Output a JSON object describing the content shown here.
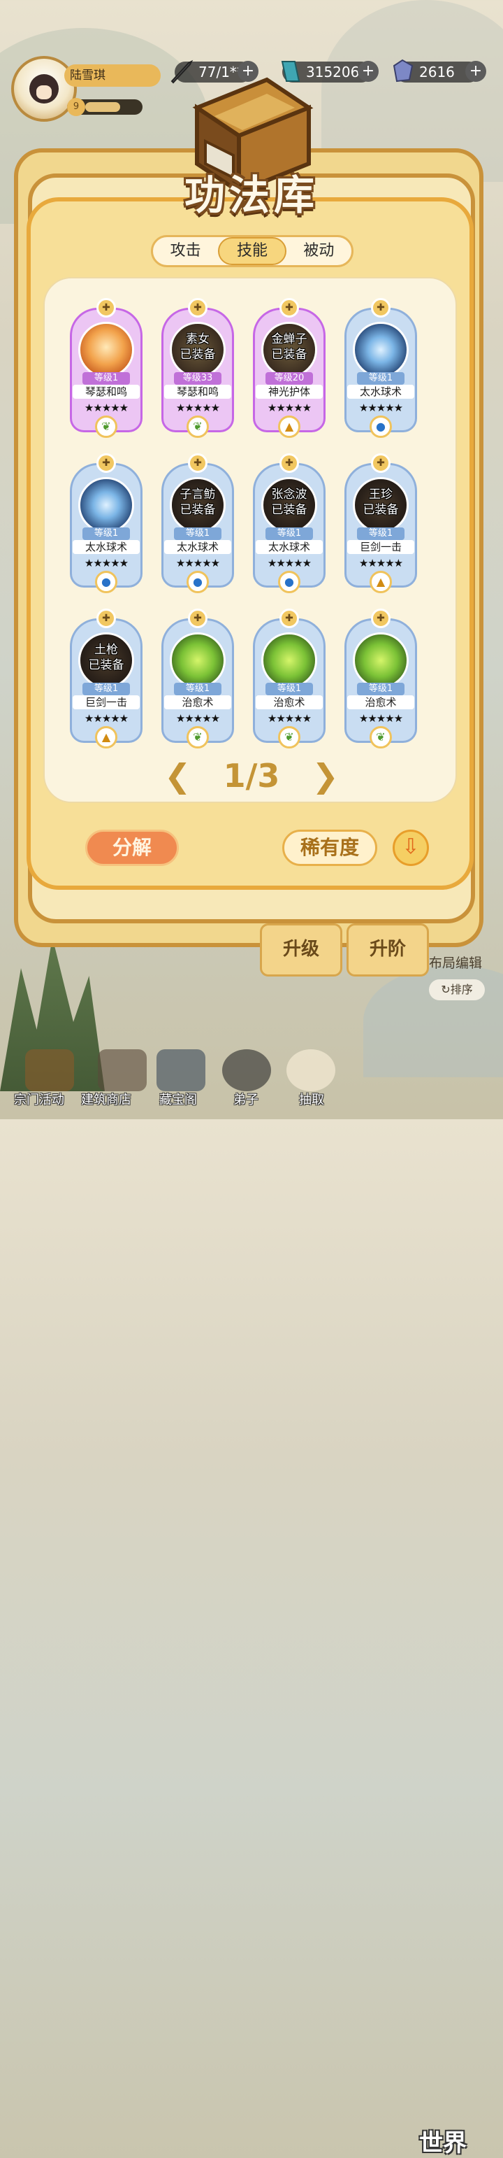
{
  "player": {
    "name": "陆雪琪",
    "level": "9"
  },
  "resources": [
    {
      "icon": "sword-icon",
      "value": "77/1**"
    },
    {
      "icon": "crystal-icon",
      "value": "315206"
    },
    {
      "icon": "gem-icon",
      "value": "2616"
    }
  ],
  "panel": {
    "title": "功法库"
  },
  "tabs": [
    {
      "label": "攻击",
      "active": false
    },
    {
      "label": "技能",
      "active": true
    },
    {
      "label": "被动",
      "active": false
    }
  ],
  "cards": [
    {
      "equipped_by": "",
      "equip_status": "",
      "level": "等级1",
      "name": "琴瑟和鸣",
      "stars": "★★★★★",
      "rarity": "pink",
      "orb": "fire",
      "element": "wood"
    },
    {
      "equipped_by": "素女",
      "equip_status": "已装备",
      "level": "等级33",
      "name": "琴瑟和鸣",
      "stars": "★★★★★",
      "rarity": "pink",
      "orb": "purple",
      "element": "wood"
    },
    {
      "equipped_by": "金蝉子",
      "equip_status": "已装备",
      "level": "等级20",
      "name": "神光护体",
      "stars": "★★★★★",
      "rarity": "pink",
      "orb": "purple",
      "element": "gold"
    },
    {
      "equipped_by": "",
      "equip_status": "",
      "level": "等级1",
      "name": "太水球术",
      "stars": "★★★★★",
      "rarity": "blue",
      "orb": "water",
      "element": "water"
    },
    {
      "equipped_by": "",
      "equip_status": "",
      "level": "等级1",
      "name": "太水球术",
      "stars": "★★★★★",
      "rarity": "blue",
      "orb": "water",
      "element": "water"
    },
    {
      "equipped_by": "子言鲂",
      "equip_status": "已装备",
      "level": "等级1",
      "name": "太水球术",
      "stars": "★★★★★",
      "rarity": "blue",
      "orb": "dark",
      "element": "water"
    },
    {
      "equipped_by": "张念波",
      "equip_status": "已装备",
      "level": "等级1",
      "name": "太水球术",
      "stars": "★★★★★",
      "rarity": "blue",
      "orb": "dark",
      "element": "water"
    },
    {
      "equipped_by": "王珍",
      "equip_status": "已装备",
      "level": "等级1",
      "name": "巨剑一击",
      "stars": "★★★★★",
      "rarity": "blue",
      "orb": "dark",
      "element": "gold"
    },
    {
      "equipped_by": "土枪",
      "equip_status": "已装备",
      "level": "等级1",
      "name": "巨剑一击",
      "stars": "★★★★★",
      "rarity": "blue",
      "orb": "dark",
      "element": "gold"
    },
    {
      "equipped_by": "",
      "equip_status": "",
      "level": "等级1",
      "name": "治愈术",
      "stars": "★★★★★",
      "rarity": "blue",
      "orb": "green",
      "element": "wood"
    },
    {
      "equipped_by": "",
      "equip_status": "",
      "level": "等级1",
      "name": "治愈术",
      "stars": "★★★★★",
      "rarity": "blue",
      "orb": "green",
      "element": "wood"
    },
    {
      "equipped_by": "",
      "equip_status": "",
      "level": "等级1",
      "name": "治愈术",
      "stars": "★★★★★",
      "rarity": "blue",
      "orb": "green",
      "element": "wood"
    }
  ],
  "pager": {
    "prev": "❮",
    "text": "1/3",
    "next": "❯"
  },
  "actions": {
    "decompose": "分解",
    "rarity": "稀有度",
    "sort_icon": "arrow-down-icon"
  },
  "under": {
    "upgrade": "升级",
    "advance": "升阶",
    "layout_edit": "布局编辑",
    "sort": "排序"
  },
  "nav": [
    {
      "label": "宗门活动"
    },
    {
      "label": "建筑商店"
    },
    {
      "label": "藏宝阁"
    },
    {
      "label": "弟子"
    },
    {
      "label": "抽取"
    }
  ],
  "world": "世界",
  "colors": {
    "panel": "#f7df98",
    "border": "#e8a93c",
    "pink": "#c667e6",
    "blue": "#8fb0db"
  }
}
